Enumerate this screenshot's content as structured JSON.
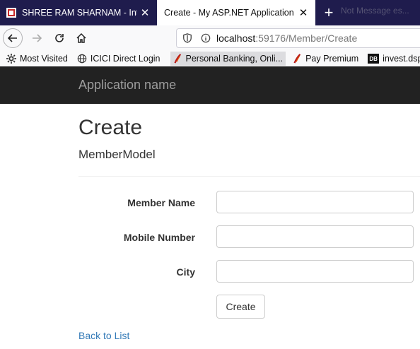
{
  "browser": {
    "tabs": [
      {
        "title": "SHREE RAM SHARNAM - Intern",
        "active": false
      },
      {
        "title": "Create - My ASP.NET Application",
        "active": true
      }
    ],
    "ghost_tab": "Not Message es...",
    "url": {
      "host": "localhost",
      "path": ":59176/Member/Create"
    },
    "bookmarks": [
      {
        "label": "Most Visited",
        "icon": "gear-icon"
      },
      {
        "label": "ICICI Direct Login",
        "icon": "globe-icon"
      },
      {
        "label": "Personal Banking, Onli...",
        "icon": "bank-feather-icon"
      },
      {
        "label": "Pay Premium",
        "icon": "bank-feather-icon"
      },
      {
        "label": "invest.dspblack",
        "icon": "db-icon"
      }
    ]
  },
  "app": {
    "brand": "Application name",
    "page_title": "Create",
    "subtitle": "MemberModel",
    "form": {
      "fields": [
        {
          "label": "Member Name",
          "value": ""
        },
        {
          "label": "Mobile Number",
          "value": ""
        },
        {
          "label": "City",
          "value": ""
        }
      ],
      "submit_label": "Create"
    },
    "back_link": "Back to List"
  },
  "colors": {
    "tabstrip": "#1f1c4d",
    "app_navbar": "#222222",
    "link": "#337ab7"
  }
}
